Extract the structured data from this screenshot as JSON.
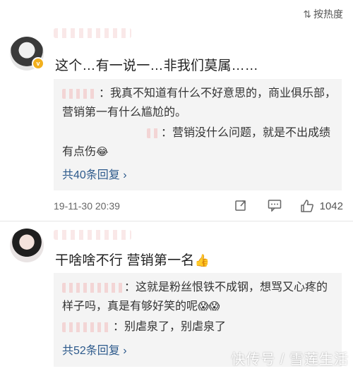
{
  "sort": {
    "icon": "sort-icon",
    "label": "按热度"
  },
  "comments": [
    {
      "avatar": "avatar-user",
      "verified_icon": "verified-badge-icon",
      "text": "这个…有一说一…非我们莫属……",
      "replies": [
        {
          "text": "我真不知道有什么不好意思的，商业俱乐部，营销第一有什么尴尬的。"
        },
        {
          "text": "营销没什么问题，就是不出成绩有点伤",
          "emoji": "😂"
        }
      ],
      "more_replies": "共40条回复 ›",
      "time": "19-11-30 20:39",
      "likes": "1042"
    },
    {
      "avatar": "avatar-user",
      "text": "干啥啥不行 营销第一名",
      "text_emoji": "👍",
      "replies": [
        {
          "text": "这就是粉丝恨铁不成钢，想骂又心疼的样子吗，真是有够好笑的呢",
          "emoji": "😱😱"
        },
        {
          "text": "别虐泉了，别虐泉了"
        }
      ],
      "more_replies": "共52条回复 ›"
    }
  ],
  "watermark": "快传号 / 雪莲生活"
}
